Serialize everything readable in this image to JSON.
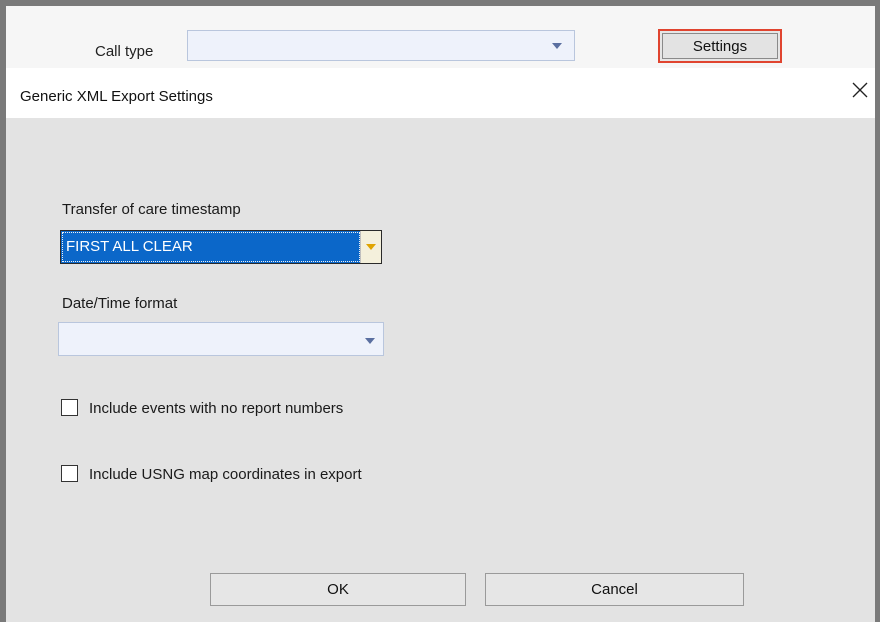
{
  "parent_form": {
    "call_type_label": "Call type",
    "call_type_value": "",
    "settings_button_label": "Settings"
  },
  "dialog": {
    "title": "Generic XML Export Settings",
    "transfer_label": "Transfer of care timestamp",
    "transfer_value": "FIRST ALL CLEAR",
    "datetime_label": "Date/Time format",
    "datetime_value": "",
    "checkbox_no_report_label": "Include events with no report numbers",
    "checkbox_no_report_checked": false,
    "checkbox_usng_label": "Include USNG map coordinates in export",
    "checkbox_usng_checked": false,
    "ok_label": "OK",
    "cancel_label": "Cancel"
  },
  "colors": {
    "highlight_border": "#e0442f",
    "selection_blue": "#0b67c9",
    "dialog_bg": "#e3e3e3"
  }
}
